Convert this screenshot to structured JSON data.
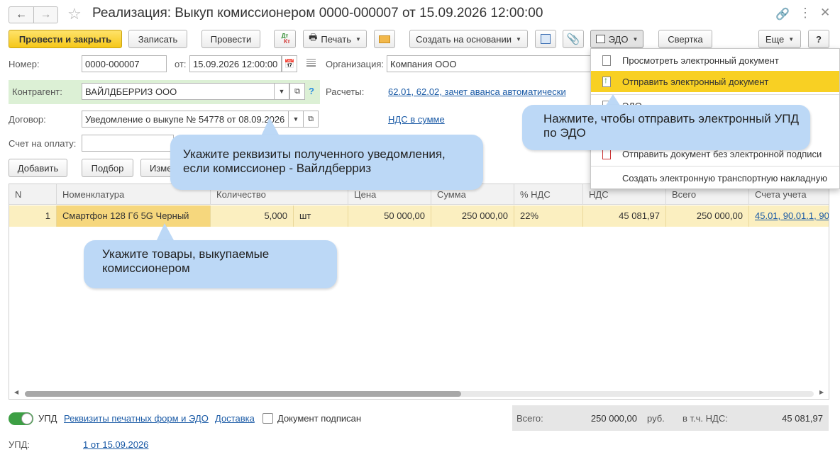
{
  "titlebar": {
    "title": "Реализация: Выкуп комиссионером 0000-000007 от 15.09.2026 12:00:00"
  },
  "toolbar": {
    "post_close": "Провести и закрыть",
    "save": "Записать",
    "post": "Провести",
    "dtkt_top": "Дт",
    "dtkt_bottom": "Кт",
    "print": "Печать",
    "create_based": "Создать на основании",
    "edo": "ЭДО",
    "collapse": "Свертка",
    "more": "Еще",
    "help": "?"
  },
  "form": {
    "number_label": "Номер:",
    "number_value": "0000-000007",
    "date_label": "от:",
    "date_value": "15.09.2026 12:00:00",
    "org_label": "Организация:",
    "org_value": "Компания ООО",
    "counterparty_label": "Контрагент:",
    "counterparty_value": "ВАЙЛДБЕРРИЗ ООО",
    "settlements_label": "Расчеты:",
    "settlements_link": "62.01, 62.02, зачет аванса автоматически",
    "contract_label": "Договор:",
    "contract_value": "Уведомление о выкупе № 54778 от 08.09.2026",
    "vat_link": "НДС в сумме",
    "invoice_label": "Счет на оплату:",
    "help_q": "?"
  },
  "table_toolbar": {
    "add": "Добавить",
    "selection": "Подбор",
    "change": "Изменить"
  },
  "table": {
    "columns": [
      "N",
      "Номенклатура",
      "Количество",
      "Цена",
      "Сумма",
      "% НДС",
      "НДС",
      "Всего",
      "Счета учета"
    ],
    "rows": [
      {
        "n": "1",
        "item": "Смартфон 128 Гб 5G Черный",
        "qty": "5,000",
        "unit": "шт",
        "price": "50 000,00",
        "sum": "250 000,00",
        "vat_rate": "22%",
        "vat": "45 081,97",
        "total": "250 000,00",
        "accounts": "45.01, 90.01.1, 90"
      }
    ]
  },
  "edo_menu": {
    "items": [
      "Просмотреть электронный документ",
      "Отправить электронный документ",
      "Отправить документ без электронной подписи",
      "Создать электронную транспортную накладную"
    ],
    "partial_item": "ЭДО"
  },
  "callouts": {
    "send_edo": "Нажмите, чтобы отправить электронный УПД по ЭДО",
    "requisites": "Укажите реквизиты полученного уведомления, если комиссионер - Вайлдберриз",
    "goods": "Укажите товары, выкупаемые комиссионером"
  },
  "footer": {
    "upd_toggle": "УПД",
    "print_forms_link": "Реквизиты печатных форм и ЭДО",
    "delivery_link": "Доставка",
    "signed_label": "Документ подписан",
    "total_label": "Всего:",
    "total_value": "250 000,00",
    "currency": "руб.",
    "vat_label": "в т.ч. НДС:",
    "vat_value": "45 081,97",
    "upd_label": "УПД:",
    "upd_link": "1 от 15.09.2026"
  },
  "colors": {
    "primary_button": "#f5c718",
    "highlight_row": "#fbefc0",
    "menu_highlight": "#f8d023",
    "callout": "#bcd8f6",
    "link": "#1a5aa6",
    "counterparty_bg": "#dcf0d5"
  }
}
